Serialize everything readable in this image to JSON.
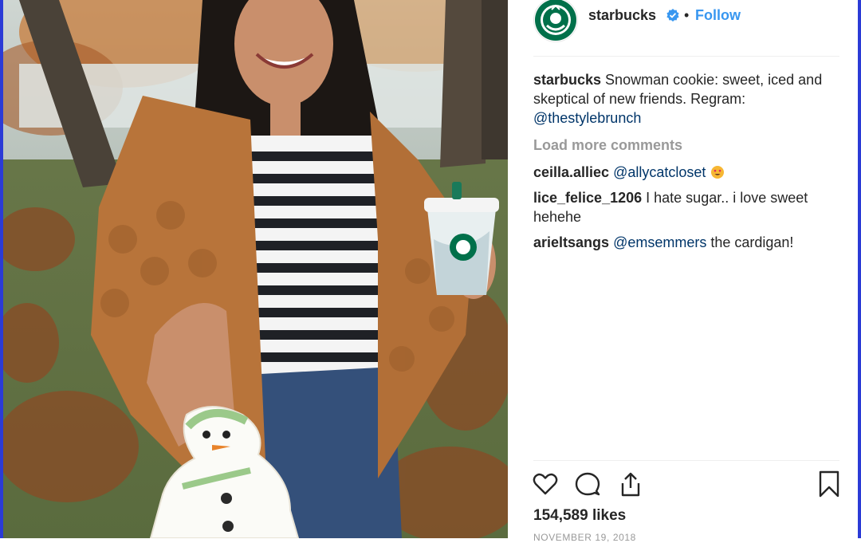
{
  "post": {
    "username": "starbucks",
    "separator": "•",
    "follow_label": "Follow",
    "caption": {
      "username": "starbucks",
      "text": " Snowman cookie: sweet, iced and skeptical of new friends. Regram: ",
      "mention": "@thestylebrunch"
    },
    "load_more_label": "Load more comments",
    "comments": [
      {
        "username": "ceilla.alliec",
        "mention": "@allycatcloset",
        "text": ""
      },
      {
        "username": "lice_felice_1206",
        "mention": "",
        "text": "I hate sugar.. i love sweet hehehe"
      },
      {
        "username": "arieltsangs",
        "mention": "@emsemmers",
        "text": " the cardigan!"
      }
    ],
    "likes": "154,589 likes",
    "date": "NOVEMBER 19, 2018"
  },
  "icons": {
    "verified": "verified-badge-icon",
    "like": "heart-icon",
    "comment": "speech-bubble-icon",
    "share": "share-icon",
    "save": "bookmark-icon",
    "avatar": "starbucks-siren-logo",
    "emoji": "heart-eyes-emoji"
  },
  "colors": {
    "link": "#3897f0",
    "mention": "#003569",
    "text": "#262626",
    "muted": "#999999",
    "frame": "#2b3bd6",
    "brand_green": "#00704a"
  }
}
